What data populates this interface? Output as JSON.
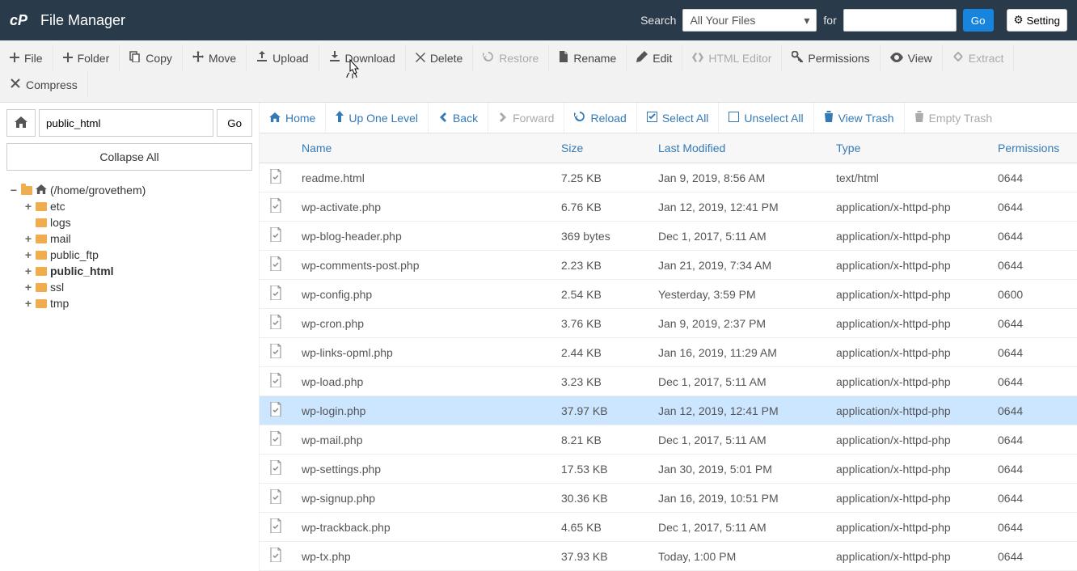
{
  "header": {
    "app_title": "File Manager",
    "search_label": "Search",
    "select_value": "All Your Files",
    "for_label": "for",
    "go_label": "Go",
    "settings_label": "Setting"
  },
  "toolbar": [
    {
      "id": "file",
      "label": "File",
      "icon": "plus",
      "disabled": false
    },
    {
      "id": "folder",
      "label": "Folder",
      "icon": "plus",
      "disabled": false
    },
    {
      "id": "copy",
      "label": "Copy",
      "icon": "copy",
      "disabled": false
    },
    {
      "id": "move",
      "label": "Move",
      "icon": "move",
      "disabled": false
    },
    {
      "id": "upload",
      "label": "Upload",
      "icon": "upload",
      "disabled": false
    },
    {
      "id": "download",
      "label": "Download",
      "icon": "download",
      "disabled": false
    },
    {
      "id": "delete",
      "label": "Delete",
      "icon": "close",
      "disabled": false
    },
    {
      "id": "restore",
      "label": "Restore",
      "icon": "restore",
      "disabled": true
    },
    {
      "id": "rename",
      "label": "Rename",
      "icon": "file",
      "disabled": false
    },
    {
      "id": "edit",
      "label": "Edit",
      "icon": "pencil",
      "disabled": false
    },
    {
      "id": "htmleditor",
      "label": "HTML Editor",
      "icon": "code",
      "disabled": true
    },
    {
      "id": "permissions",
      "label": "Permissions",
      "icon": "key",
      "disabled": false
    },
    {
      "id": "view",
      "label": "View",
      "icon": "eye",
      "disabled": false
    },
    {
      "id": "extract",
      "label": "Extract",
      "icon": "extract",
      "disabled": true
    },
    {
      "id": "compress",
      "label": "Compress",
      "icon": "compress",
      "disabled": false
    }
  ],
  "sidebar": {
    "path_value": "public_html",
    "go_label": "Go",
    "collapse_label": "Collapse All",
    "root_label": "(/home/grovethem)",
    "tree": [
      {
        "label": "etc",
        "expandable": true,
        "bold": false
      },
      {
        "label": "logs",
        "expandable": false,
        "bold": false
      },
      {
        "label": "mail",
        "expandable": true,
        "bold": false
      },
      {
        "label": "public_ftp",
        "expandable": true,
        "bold": false
      },
      {
        "label": "public_html",
        "expandable": true,
        "bold": true
      },
      {
        "label": "ssl",
        "expandable": true,
        "bold": false
      },
      {
        "label": "tmp",
        "expandable": true,
        "bold": false
      }
    ]
  },
  "pane_toolbar": [
    {
      "id": "home",
      "label": "Home",
      "icon": "home",
      "disabled": false
    },
    {
      "id": "up",
      "label": "Up One Level",
      "icon": "up",
      "disabled": false
    },
    {
      "id": "back",
      "label": "Back",
      "icon": "left",
      "disabled": false
    },
    {
      "id": "forward",
      "label": "Forward",
      "icon": "right",
      "disabled": true
    },
    {
      "id": "reload",
      "label": "Reload",
      "icon": "reload",
      "disabled": false
    },
    {
      "id": "selectall",
      "label": "Select All",
      "icon": "check",
      "disabled": false
    },
    {
      "id": "unselectall",
      "label": "Unselect All",
      "icon": "uncheck",
      "disabled": false
    },
    {
      "id": "viewtrash",
      "label": "View Trash",
      "icon": "trash",
      "disabled": false
    },
    {
      "id": "emptytrash",
      "label": "Empty Trash",
      "icon": "trash",
      "disabled": true
    }
  ],
  "columns": {
    "name": "Name",
    "size": "Size",
    "modified": "Last Modified",
    "type": "Type",
    "permissions": "Permissions"
  },
  "files": [
    {
      "name": "readme.html",
      "size": "7.25 KB",
      "modified": "Jan 9, 2019, 8:56 AM",
      "type": "text/html",
      "perm": "0644",
      "selected": false
    },
    {
      "name": "wp-activate.php",
      "size": "6.76 KB",
      "modified": "Jan 12, 2019, 12:41 PM",
      "type": "application/x-httpd-php",
      "perm": "0644",
      "selected": false
    },
    {
      "name": "wp-blog-header.php",
      "size": "369 bytes",
      "modified": "Dec 1, 2017, 5:11 AM",
      "type": "application/x-httpd-php",
      "perm": "0644",
      "selected": false
    },
    {
      "name": "wp-comments-post.php",
      "size": "2.23 KB",
      "modified": "Jan 21, 2019, 7:34 AM",
      "type": "application/x-httpd-php",
      "perm": "0644",
      "selected": false
    },
    {
      "name": "wp-config.php",
      "size": "2.54 KB",
      "modified": "Yesterday, 3:59 PM",
      "type": "application/x-httpd-php",
      "perm": "0600",
      "selected": false
    },
    {
      "name": "wp-cron.php",
      "size": "3.76 KB",
      "modified": "Jan 9, 2019, 2:37 PM",
      "type": "application/x-httpd-php",
      "perm": "0644",
      "selected": false
    },
    {
      "name": "wp-links-opml.php",
      "size": "2.44 KB",
      "modified": "Jan 16, 2019, 11:29 AM",
      "type": "application/x-httpd-php",
      "perm": "0644",
      "selected": false
    },
    {
      "name": "wp-load.php",
      "size": "3.23 KB",
      "modified": "Dec 1, 2017, 5:11 AM",
      "type": "application/x-httpd-php",
      "perm": "0644",
      "selected": false
    },
    {
      "name": "wp-login.php",
      "size": "37.97 KB",
      "modified": "Jan 12, 2019, 12:41 PM",
      "type": "application/x-httpd-php",
      "perm": "0644",
      "selected": true
    },
    {
      "name": "wp-mail.php",
      "size": "8.21 KB",
      "modified": "Dec 1, 2017, 5:11 AM",
      "type": "application/x-httpd-php",
      "perm": "0644",
      "selected": false
    },
    {
      "name": "wp-settings.php",
      "size": "17.53 KB",
      "modified": "Jan 30, 2019, 5:01 PM",
      "type": "application/x-httpd-php",
      "perm": "0644",
      "selected": false
    },
    {
      "name": "wp-signup.php",
      "size": "30.36 KB",
      "modified": "Jan 16, 2019, 10:51 PM",
      "type": "application/x-httpd-php",
      "perm": "0644",
      "selected": false
    },
    {
      "name": "wp-trackback.php",
      "size": "4.65 KB",
      "modified": "Dec 1, 2017, 5:11 AM",
      "type": "application/x-httpd-php",
      "perm": "0644",
      "selected": false
    },
    {
      "name": "wp-tx.php",
      "size": "37.93 KB",
      "modified": "Today, 1:00 PM",
      "type": "application/x-httpd-php",
      "perm": "0644",
      "selected": false
    }
  ]
}
